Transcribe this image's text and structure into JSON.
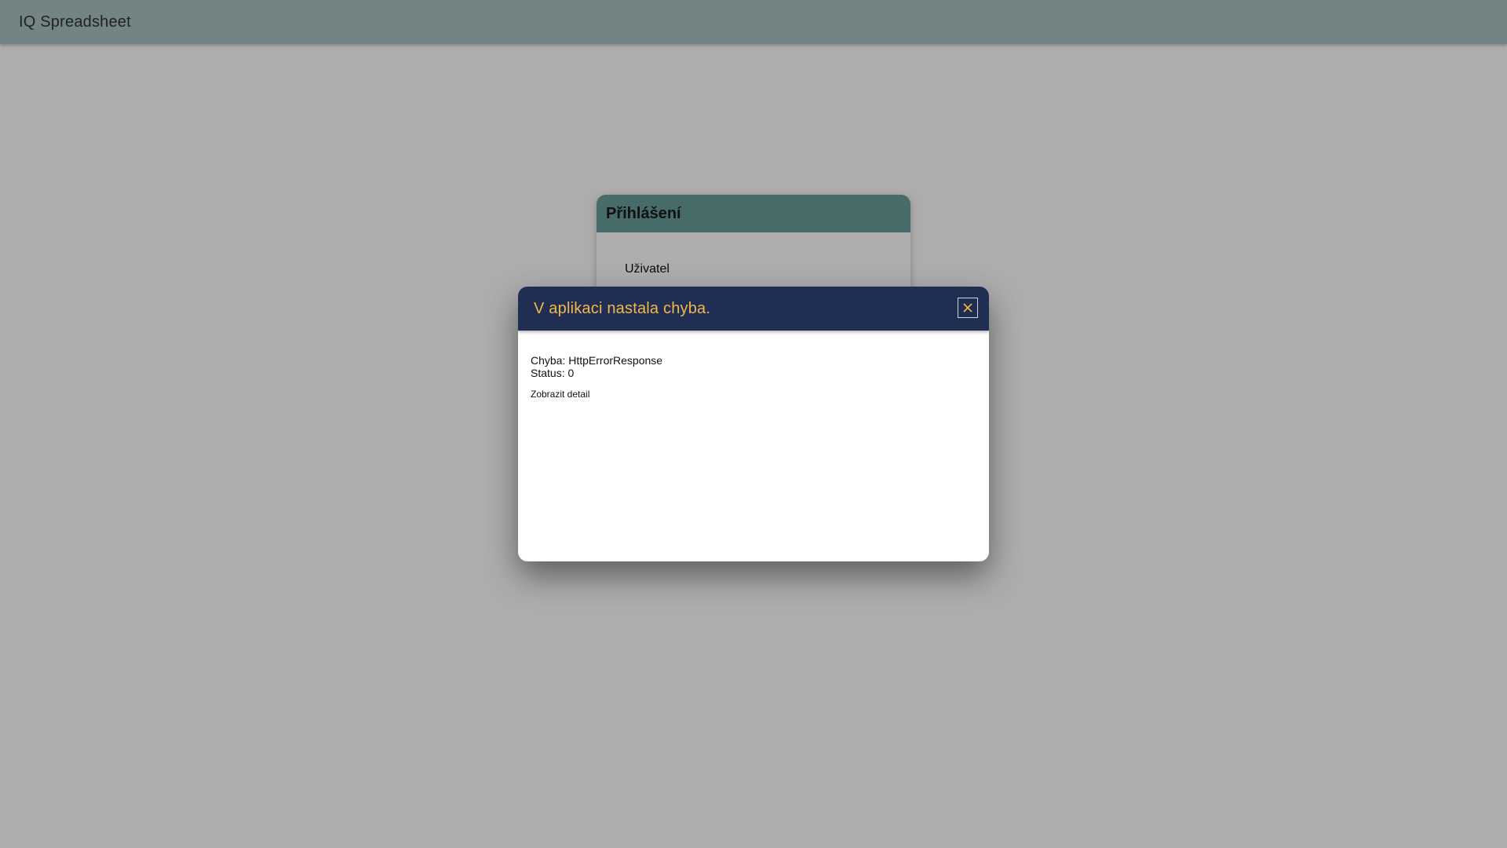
{
  "app": {
    "title": "IQ Spreadsheet"
  },
  "login": {
    "title": "Přihlášení",
    "user_label": "Uživatel"
  },
  "dialog": {
    "title": "V aplikaci nastala chyba.",
    "error_line": "Chyba: HttpErrorResponse",
    "status_line": "Status: 0",
    "detail_link": "Zobrazit detail",
    "close_icon": "close-icon"
  },
  "colors": {
    "app_header": "#a9c3c3",
    "login_header": "#699e9b",
    "dialog_header": "#1f2e52",
    "dialog_title": "#f2b84b",
    "backdrop": "rgba(0,0,0,0.32)"
  }
}
